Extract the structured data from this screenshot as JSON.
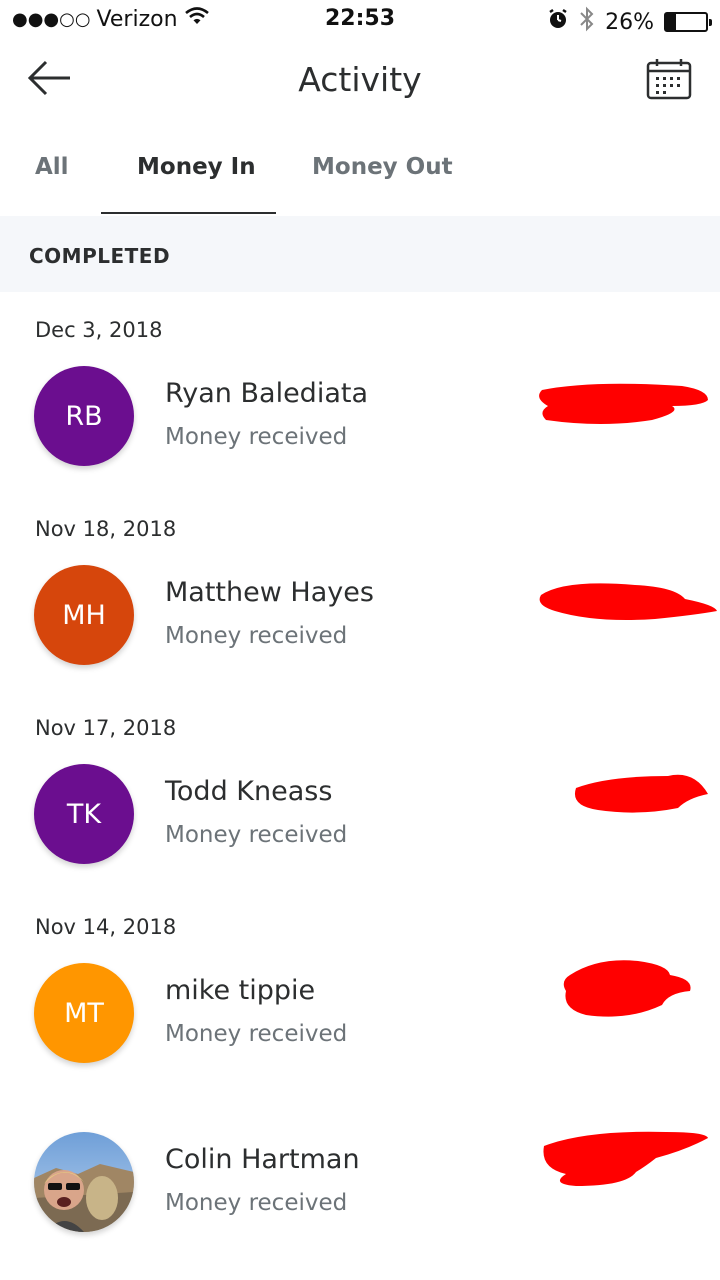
{
  "status": {
    "carrier": "Verizon",
    "signal": "●●●○○",
    "time": "22:53",
    "battery_percent": "26%",
    "battery_level": 0.26
  },
  "header": {
    "title": "Activity",
    "back_icon": "arrow-left-icon",
    "calendar_icon": "calendar-icon"
  },
  "tabs": [
    {
      "label": "All",
      "active": false
    },
    {
      "label": "Money In",
      "active": true
    },
    {
      "label": "Money Out",
      "active": false
    }
  ],
  "section": {
    "label": "COMPLETED"
  },
  "items": [
    {
      "date": "Dec 3, 2018",
      "initials": "RB",
      "name": "Ryan Balediata",
      "subtitle": "Money received",
      "avatar_color": "#6b0e8f"
    },
    {
      "date": "Nov 18, 2018",
      "initials": "MH",
      "name": "Matthew Hayes",
      "subtitle": "Money received",
      "avatar_color": "#d6460c"
    },
    {
      "date": "Nov 17, 2018",
      "initials": "TK",
      "name": "Todd Kneass",
      "subtitle": "Money received",
      "avatar_color": "#6b0e8f"
    },
    {
      "date": "Nov 14, 2018",
      "initials": "MT",
      "name": "mike tippie",
      "subtitle": "Money received",
      "avatar_color": "#ff9600"
    },
    {
      "date": "",
      "initials": "",
      "name": "Colin Hartman",
      "subtitle": "Money received",
      "avatar_color": "#7a8a96"
    }
  ],
  "colors": {
    "redaction": "#ff0000",
    "section_bg": "#f5f7fa",
    "text_primary": "#2c2e2f",
    "text_secondary": "#6c7378"
  }
}
